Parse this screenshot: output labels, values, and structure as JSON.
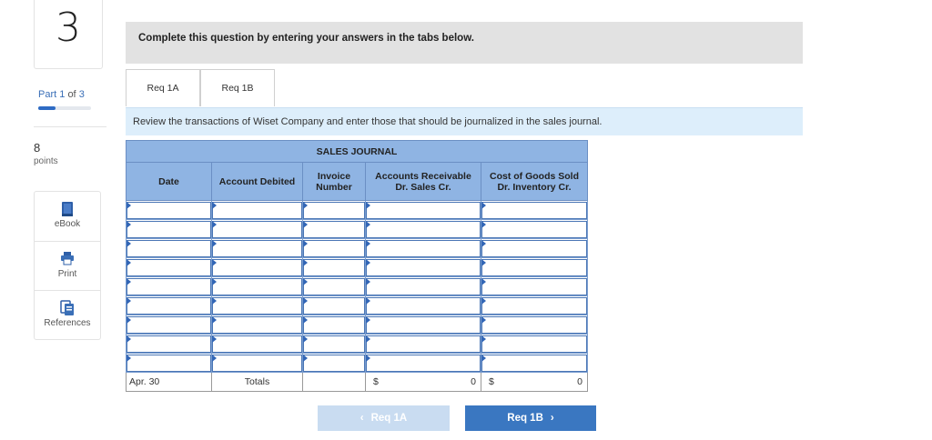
{
  "question": {
    "number": "3",
    "part_current": "1",
    "part_of": "of",
    "part_total": "3",
    "part_word": "Part",
    "progress_fraction": 0.33,
    "points_value": "8",
    "points_label": "points"
  },
  "tools": [
    {
      "label": "eBook",
      "icon": "book-icon"
    },
    {
      "label": "Print",
      "icon": "printer-icon"
    },
    {
      "label": "References",
      "icon": "references-icon"
    }
  ],
  "banner": {
    "text": "Complete this question by entering your answers in the tabs below."
  },
  "tabs": [
    {
      "label": "Req 1A"
    },
    {
      "label": "Req 1B"
    }
  ],
  "instructions": "Review the transactions of Wiset Company and enter those that should be journalized in the sales journal.",
  "journal": {
    "title": "SALES JOURNAL",
    "headers": {
      "date": "Date",
      "account": "Account Debited",
      "invoice_1": "Invoice",
      "invoice_2": "Number",
      "ar_1": "Accounts Receivable",
      "ar_2": "Dr. Sales Cr.",
      "cogs_1": "Cost of Goods Sold",
      "cogs_2": "Dr. Inventory Cr."
    },
    "entry_rows": 9,
    "totals": {
      "date": "Apr. 30",
      "label": "Totals",
      "ar_currency": "$",
      "ar_value": "0",
      "cogs_currency": "$",
      "cogs_value": "0"
    }
  },
  "nav": {
    "prev_label": "Req 1A",
    "next_label": "Req 1B",
    "prev_arrow": "‹",
    "next_arrow": "›"
  },
  "colors": {
    "accent": "#3a77c1",
    "header_bg": "#8fb4e3",
    "instructions_bg": "#ddeefb",
    "banner_bg": "#e2e2e2"
  }
}
